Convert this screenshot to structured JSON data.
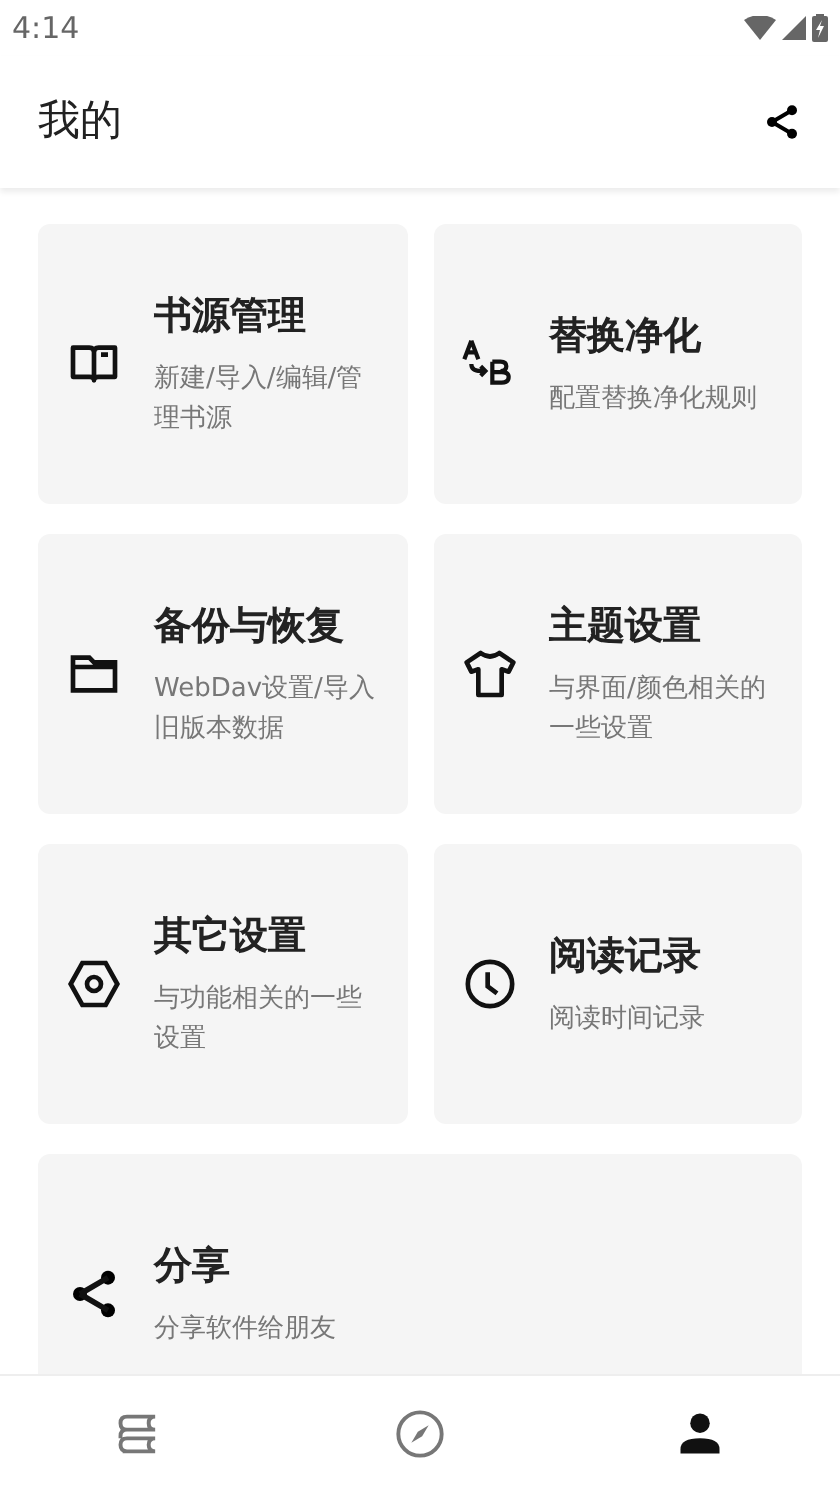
{
  "status_bar": {
    "time": "4:14"
  },
  "toolbar": {
    "title": "我的"
  },
  "cards": [
    {
      "kind": "book",
      "title": "书源管理",
      "description": "新建/导入/编辑/管理书源"
    },
    {
      "kind": "replace",
      "title": "替换净化",
      "description": "配置替换净化规则"
    },
    {
      "kind": "folder",
      "title": "备份与恢复",
      "description": "WebDav设置/导入旧版本数据"
    },
    {
      "kind": "shirt",
      "title": "主题设置",
      "description": "与界面/颜色相关的一些设置"
    },
    {
      "kind": "nut",
      "title": "其它设置",
      "description": "与功能相关的一些设置"
    },
    {
      "kind": "clock",
      "title": "阅读记录",
      "description": "阅读时间记录"
    },
    {
      "kind": "share",
      "title": "分享",
      "description": "分享软件给朋友"
    }
  ],
  "bottom_nav": [
    {
      "kind": "books",
      "selected": false
    },
    {
      "kind": "compass",
      "selected": false
    },
    {
      "kind": "person",
      "selected": true
    }
  ]
}
